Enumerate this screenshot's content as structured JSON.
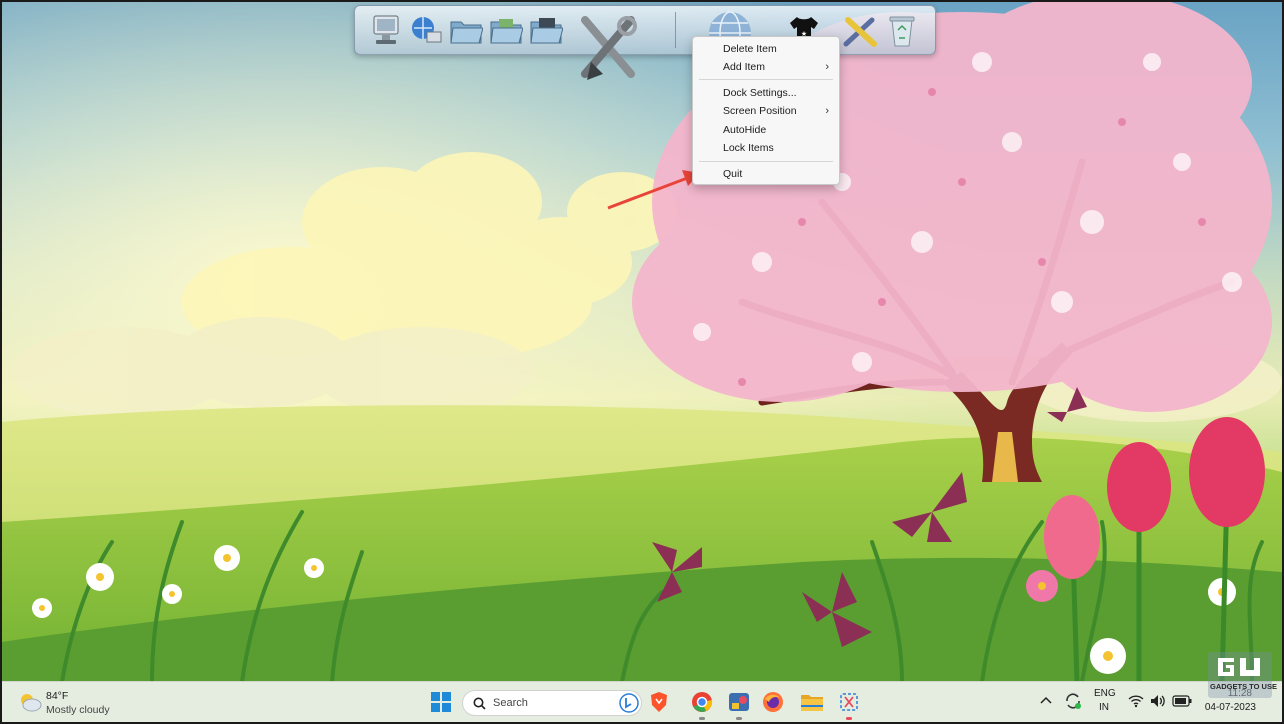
{
  "dock": {
    "items": [
      {
        "name": "computer-icon"
      },
      {
        "name": "network-icon"
      },
      {
        "name": "documents-folder-icon"
      },
      {
        "name": "pictures-folder-icon"
      },
      {
        "name": "music-folder-icon"
      },
      {
        "name": "tools-icon"
      },
      {
        "name": "globe-icon"
      },
      {
        "name": "shirt-icon"
      },
      {
        "name": "settings-tools-icon"
      },
      {
        "name": "recycle-bin-icon"
      }
    ]
  },
  "context_menu": {
    "delete_item": "Delete Item",
    "add_item": "Add Item",
    "dock_settings": "Dock Settings...",
    "screen_position": "Screen Position",
    "autohide": "AutoHide",
    "lock_items": "Lock Items",
    "quit": "Quit",
    "submenu_chevron": "›"
  },
  "annotation": {
    "arrow_color": "#e8443a"
  },
  "taskbar": {
    "weather_temp": "84°F",
    "weather_desc": "Mostly cloudy",
    "search_placeholder": "Search",
    "lang_primary": "ENG",
    "lang_secondary": "IN",
    "time": "11:28",
    "date": "04-07-2023",
    "watermark": "GADGETS TO USE"
  },
  "colors": {
    "taskbar_bg": "#eef2ec",
    "menu_bg": "#f7f7f7",
    "blossom": "#f4b6cc",
    "tulip": "#e23a64"
  }
}
